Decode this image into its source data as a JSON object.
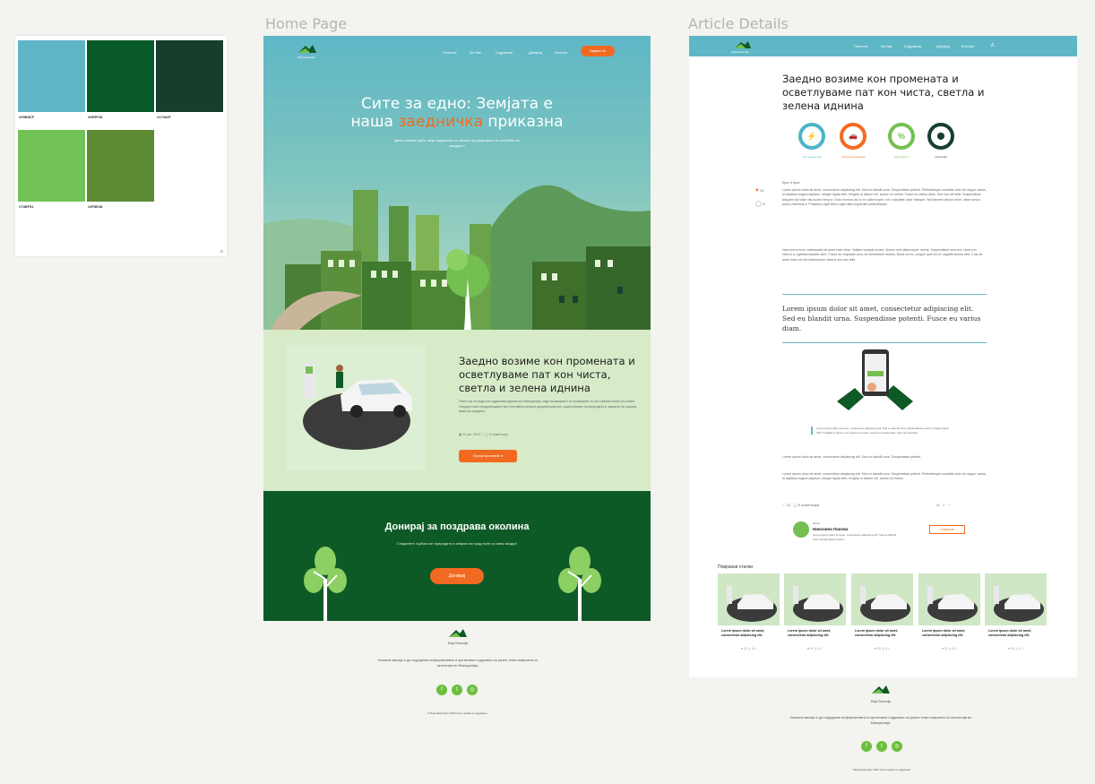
{
  "frames": {
    "home_label": "Home Page",
    "article_label": "Article Details"
  },
  "palette": {
    "swatches": [
      {
        "hex": "#65B8CF",
        "name": "",
        "note": "",
        "color": "#5fb5c6"
      },
      {
        "hex": "#0E5F28",
        "name": "",
        "note": "",
        "color": "#075a28"
      },
      {
        "hex": "#17402F",
        "name": "",
        "note": "",
        "color": "#173d2b"
      },
      {
        "hex": "#74BF51",
        "name": "",
        "note": "",
        "color": "#72c356"
      },
      {
        "hex": "#5F8E38",
        "name": "",
        "note": "",
        "color": "#5d8c35"
      }
    ]
  },
  "home": {
    "brand": "Moja Ekoloxija",
    "nav": [
      "Почетна",
      "За Нас",
      "Содржина",
      "Донирај",
      "Контакт"
    ],
    "nav_cta": "Најави се",
    "hero_title_1": "Сите за едно: Земјата е",
    "hero_title_2a": "наша ",
    "hero_title_accent": "заедничка",
    "hero_title_2b": " приказна",
    "hero_sub": "Дали знаевте дека твоја заедничка со своите од природата се потребни за моодуот?",
    "feature_title": "Заедно возиме кон промената и осветлуваме пат кон чиста, светла и зелена иднина",
    "feature_body": "Патот кој не води кон одржлива иднина во Македонија, каде иновациите се прифаќаат со еко-свесни начин на живот. Откријте како придонесувате кон поставени возила допринесува кон заштитување на природата и заштита на нашата животна средина.",
    "feature_date": "01 јан, 2023",
    "feature_comments": "5 коментари",
    "feature_cta": "Прочитај повеќе",
    "donate_title": "Донирај за поздрава околина",
    "donate_sub": "Споделете љубов кон природата и земјата во град полн со свеж воздух!",
    "donate_cta": "Донирај",
    "footer_brand": "Moja Ekoloxija",
    "footer_text": "Нашата мисија е да подадеме информативни и креативни содржини за разни теми поврзани со екологија во Македонија.",
    "footer_social": [
      "f",
      "t",
      "◎"
    ],
    "copyright": "© Moja Ekoloxija© 2023 Сите права се задржани"
  },
  "article": {
    "brand": "Moja Ekoloxija",
    "nav": [
      "Почетна",
      "За Нас",
      "Содржина",
      "Донирај",
      "Контакт"
    ],
    "title": "Заедно возиме кон промената и осветлуваме пат кон чиста, светла и зелена иднина",
    "rings": [
      {
        "label": "чиста енергија",
        "glyph": "⚡",
        "color": "#4db4c8"
      },
      {
        "label": "електрични возила",
        "glyph": "🚗",
        "color": "#f26a21"
      },
      {
        "label": "одржливост",
        "glyph": "%",
        "color": "#74bf51"
      },
      {
        "label": "екологија",
        "glyph": "⬤",
        "color": "#17402f"
      }
    ],
    "author_short": "Брат Б Брат",
    "likes": "31",
    "comments": "8",
    "p1": "Lorem ipsum dolor sit amet, consectetur adipiscing elit. Sed eu blandit urna. Suspendisse potenti. Pellentesque convallis ante vel augue varius, id dapibus magna dapibus. Integer ligula nibh, fringilla ut dictum vel, auctor eu metus. Fusce eu varius diam. Sed non elit felis. Suspendisse aliquam dui vitae nisi auctor tempor. Duis rhoncus dui in ex ullamcorper, nec vulputate dolor tristique. Sed laoreet dictum enim, vitae cursus purus maximus a. Phasellus eget libero eget diam imperdiet pellentesque.",
    "p2": "Nam lorem eros, malesuada sit amet enim vitae. Nullam suscipit ornare. Donec sed ullamcorper metus. Suspendisse urna est, viverra in viverra a, egestas sodales sem. Fusce ac vulputate arcu, sit elementum massa. Nulla vel ex, congue quis leo et, sagittis lacinia velit. Cras sit amet nunc vel dui ullamcorper viverra non non felis.",
    "quote": "Lorem ipsum dolor sit amet, consectetur adipiscing elit. Sed eu blandit urna. Suspendisse potenti. Fusce eu varius diam.",
    "caption": "Lorem ipsum dolor sit amet, consectetur adipiscing elit. Sed eu blandit urna. Suspendisse potenti. Integer ligula nibh. Fringilla ut dictum vel, auctor eu metus. Fusce eu varius diam. Sed non elit felis.",
    "p3": "Lorem ipsum dolor sit amet, consectetur adipiscing elit. Sed eu blandit urna. Suspendisse potenti.",
    "p4": "Lorem ipsum dolor sit amet, consectetur adipiscing elit. Sed eu blandit urna. Suspendisse potenti. Pellentesque convallis ante vel augue varius, id dapibus magna dapibus. Integer ligula nibh, fringilla ut dictum vel, auctor eu metus.",
    "bottom_likes": "31",
    "bottom_comments": "8 коментари",
    "author_label": "Автор",
    "author_name": "Николина Панова",
    "author_bio": "Lorem ipsum dolor sit amet, consectetur adipiscing elit. Sed eu blandit urna. Suspendisse potenti.",
    "follow": "Следи ме",
    "related_title": "Поврзани статии",
    "related": [
      {
        "title": "Lorem ipsum dolor sit amet, consectetur adipiscing elit.",
        "meta": "♥ 31   ◎ 8   ⌂"
      },
      {
        "title": "Lorem ipsum dolor sit amet, consectetur adipiscing elit.",
        "meta": "♥ 31   ◎ 8   ⌂"
      },
      {
        "title": "Lorem ipsum dolor sit amet, consectetur adipiscing elit.",
        "meta": "♥ 31   ◎ 8   ⌂"
      },
      {
        "title": "Lorem ipsum dolor sit amet, consectetur adipiscing elit.",
        "meta": "♥ 31   ◎ 8   ⌂"
      },
      {
        "title": "Lorem ipsum dolor sit amet, consectetur adipiscing elit.",
        "meta": "♥ 31   ◎ 8   ⌂"
      }
    ],
    "footer_brand": "Moja Ekoloxija",
    "footer_text": "Нашата мисија е да подадеме информативни и креативни содржини за разни теми поврзани со екологија во Македонија.",
    "copyright": "Moja Ekoloxija© 2023 Сите права се задржани"
  }
}
